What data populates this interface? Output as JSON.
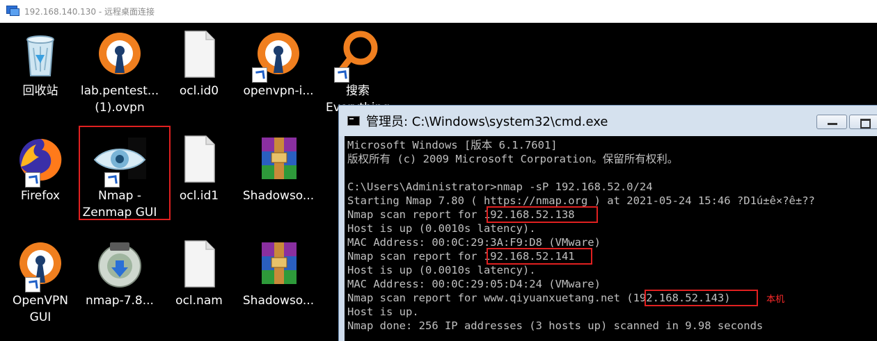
{
  "rdp": {
    "title": "192.168.140.130 - 远程桌面连接"
  },
  "desktop": {
    "icons": [
      {
        "label": "回收站"
      },
      {
        "label": "lab.pentest...\n(1).ovpn"
      },
      {
        "label": "ocl.id0"
      },
      {
        "label": "openvpn-i..."
      },
      {
        "label": "搜索\nEverything"
      },
      {
        "label": "Firefox"
      },
      {
        "label": "Nmap -\nZenmap GUI"
      },
      {
        "label": "ocl.id1"
      },
      {
        "label": "Shadowso..."
      },
      {
        "label": "OpenVPN\nGUI"
      },
      {
        "label": "nmap-7.8..."
      },
      {
        "label": "ocl.nam"
      },
      {
        "label": "Shadowso..."
      }
    ]
  },
  "cmd": {
    "title": "管理员: C:\\Windows\\system32\\cmd.exe",
    "lines": [
      "Microsoft Windows [版本 6.1.7601]",
      "版权所有 (c) 2009 Microsoft Corporation。保留所有权利。",
      "",
      "C:\\Users\\Administrator>nmap -sP 192.168.52.0/24",
      "Starting Nmap 7.80 ( https://nmap.org ) at 2021-05-24 15:46 ?D1ú±ê×?ê±??",
      "Nmap scan report for 192.168.52.138",
      "Host is up (0.0010s latency).",
      "MAC Address: 00:0C:29:3A:F9:D8 (VMware)",
      "Nmap scan report for 192.168.52.141",
      "Host is up (0.0010s latency).",
      "MAC Address: 00:0C:29:05:D4:24 (VMware)",
      "Nmap scan report for www.qiyuanxuetang.net (192.168.52.143)",
      "Host is up.",
      "Nmap done: 256 IP addresses (3 hosts up) scanned in 9.98 seconds"
    ],
    "annotation": "本机"
  },
  "colors": {
    "highlight": "#e02020",
    "console_text": "#c0c0c0",
    "annotation": "#ff2a2a"
  }
}
